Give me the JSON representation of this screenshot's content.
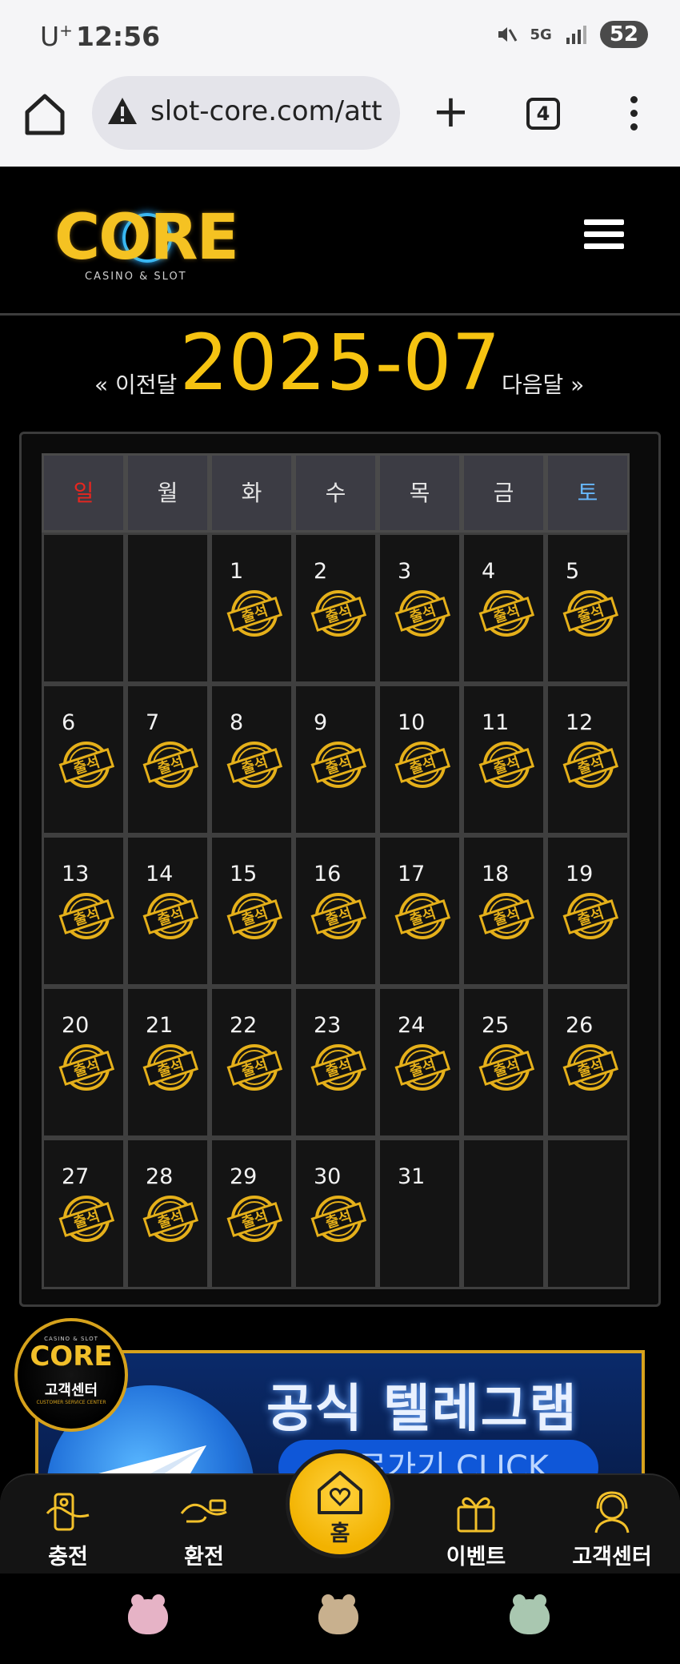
{
  "status_bar": {
    "carrier": "U",
    "carrier_sup": "+",
    "time": "12:56",
    "network": "5G",
    "battery": "52"
  },
  "browser": {
    "url": "slot-core.com/att",
    "tab_count": "4"
  },
  "header": {
    "logo_text": "CORE",
    "logo_subtitle": "CASINO & SLOT"
  },
  "month_nav": {
    "prev_label": "« 이전달",
    "title": "2025-07",
    "next_label": "다음달 »"
  },
  "calendar": {
    "weekdays": [
      "일",
      "월",
      "화",
      "수",
      "목",
      "금",
      "토"
    ],
    "stamp_label": "출석",
    "weeks": [
      [
        {
          "day": ""
        },
        {
          "day": ""
        },
        {
          "day": "1",
          "stamp": true
        },
        {
          "day": "2",
          "stamp": true
        },
        {
          "day": "3",
          "stamp": true
        },
        {
          "day": "4",
          "stamp": true
        },
        {
          "day": "5",
          "stamp": true
        }
      ],
      [
        {
          "day": "6",
          "stamp": true
        },
        {
          "day": "7",
          "stamp": true
        },
        {
          "day": "8",
          "stamp": true
        },
        {
          "day": "9",
          "stamp": true
        },
        {
          "day": "10",
          "stamp": true
        },
        {
          "day": "11",
          "stamp": true
        },
        {
          "day": "12",
          "stamp": true
        }
      ],
      [
        {
          "day": "13",
          "stamp": true
        },
        {
          "day": "14",
          "stamp": true
        },
        {
          "day": "15",
          "stamp": true
        },
        {
          "day": "16",
          "stamp": true
        },
        {
          "day": "17",
          "stamp": true
        },
        {
          "day": "18",
          "stamp": true
        },
        {
          "day": "19",
          "stamp": true
        }
      ],
      [
        {
          "day": "20",
          "stamp": true
        },
        {
          "day": "21",
          "stamp": true
        },
        {
          "day": "22",
          "stamp": true
        },
        {
          "day": "23",
          "stamp": true
        },
        {
          "day": "24",
          "stamp": true
        },
        {
          "day": "25",
          "stamp": true
        },
        {
          "day": "26",
          "stamp": true
        }
      ],
      [
        {
          "day": "27",
          "stamp": true
        },
        {
          "day": "28",
          "stamp": true
        },
        {
          "day": "29",
          "stamp": true
        },
        {
          "day": "30",
          "stamp": true
        },
        {
          "day": "31"
        },
        {
          "day": ""
        },
        {
          "day": ""
        }
      ]
    ]
  },
  "badge": {
    "logo": "CORE",
    "subtitle": "CASINO & SLOT",
    "label": "고객센터",
    "footer": "CUSTOMER SERVICE CENTER"
  },
  "banner": {
    "title": "공식 텔레그램",
    "subtitle": "바로가기 CLICK"
  },
  "bottom_nav": {
    "deposit": "충전",
    "withdraw": "환전",
    "home": "홈",
    "event": "이벤트",
    "support": "고객센터"
  },
  "colors": {
    "accent_gold": "#f6c311",
    "sunday_red": "#e8261f",
    "saturday_blue": "#67b8ff"
  }
}
